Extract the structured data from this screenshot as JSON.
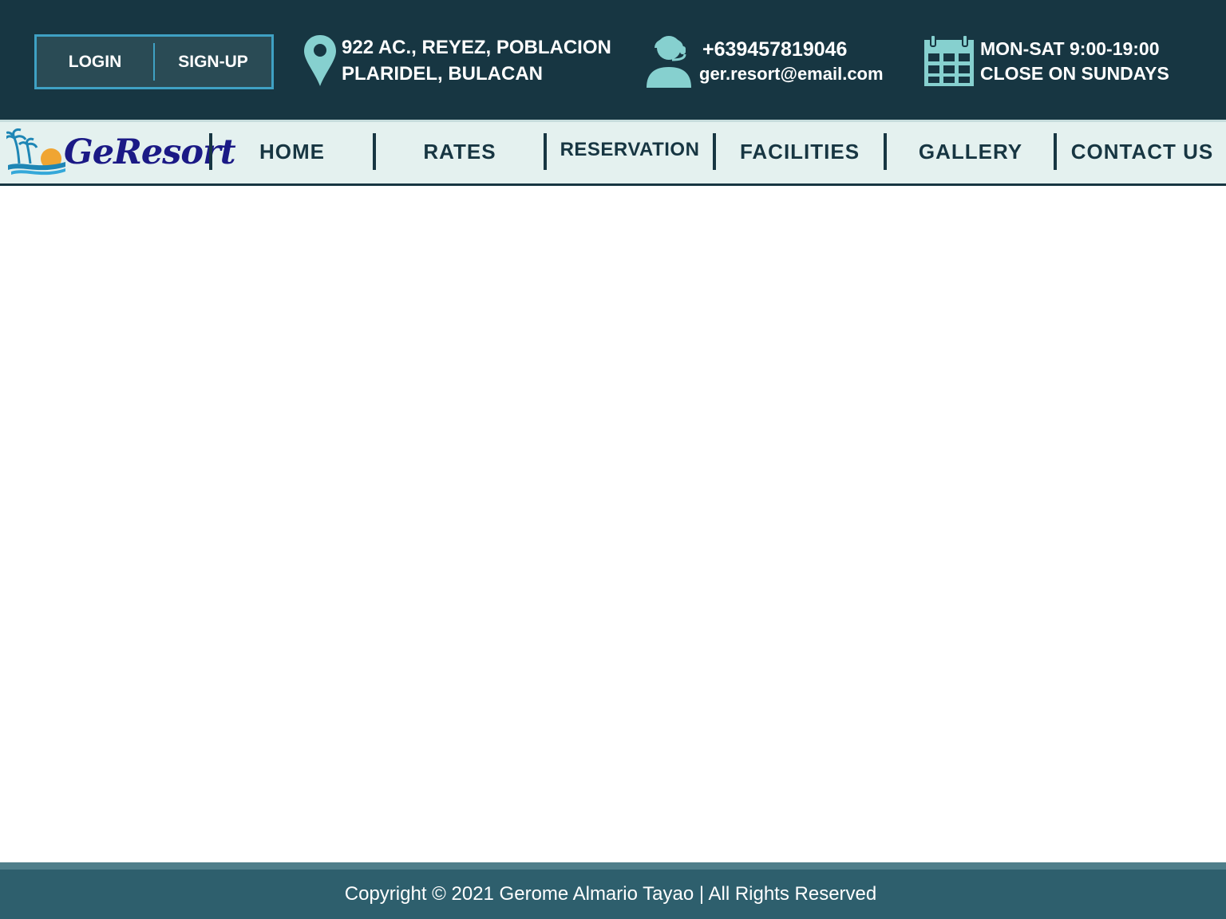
{
  "colors": {
    "topbar_bg": "#173642",
    "accent_teal": "#86d0cf",
    "auth_border": "#3fa1c4",
    "nav_bg": "#e4f1ef",
    "nav_text": "#173642",
    "logo_text": "#1b1a86",
    "footer_bg": "#2e5f6d"
  },
  "auth": {
    "login_label": "LOGIN",
    "signup_label": "SIGN-UP"
  },
  "address": {
    "icon": "map-pin-icon",
    "line1": "922 AC., REYEZ, POBLACION",
    "line2": "PLARIDEL, BULACAN"
  },
  "contact": {
    "icon": "headset-support-icon",
    "phone": "+639457819046",
    "email": "ger.resort@email.com"
  },
  "hours": {
    "icon": "calendar-icon",
    "line1": "MON-SAT 9:00-19:00",
    "line2": "CLOSE ON SUNDAYS"
  },
  "logo": {
    "text": "GeResort",
    "icon": "palm-sunset-waves-icon"
  },
  "nav": {
    "items": [
      {
        "label": "HOME"
      },
      {
        "label": "RATES"
      },
      {
        "label": "RESERVATION"
      },
      {
        "label": "FACILITIES"
      },
      {
        "label": "GALLERY"
      },
      {
        "label": "CONTACT US"
      }
    ]
  },
  "footer": {
    "copyright": "Copyright © 2021 Gerome Almario Tayao | All Rights Reserved"
  }
}
